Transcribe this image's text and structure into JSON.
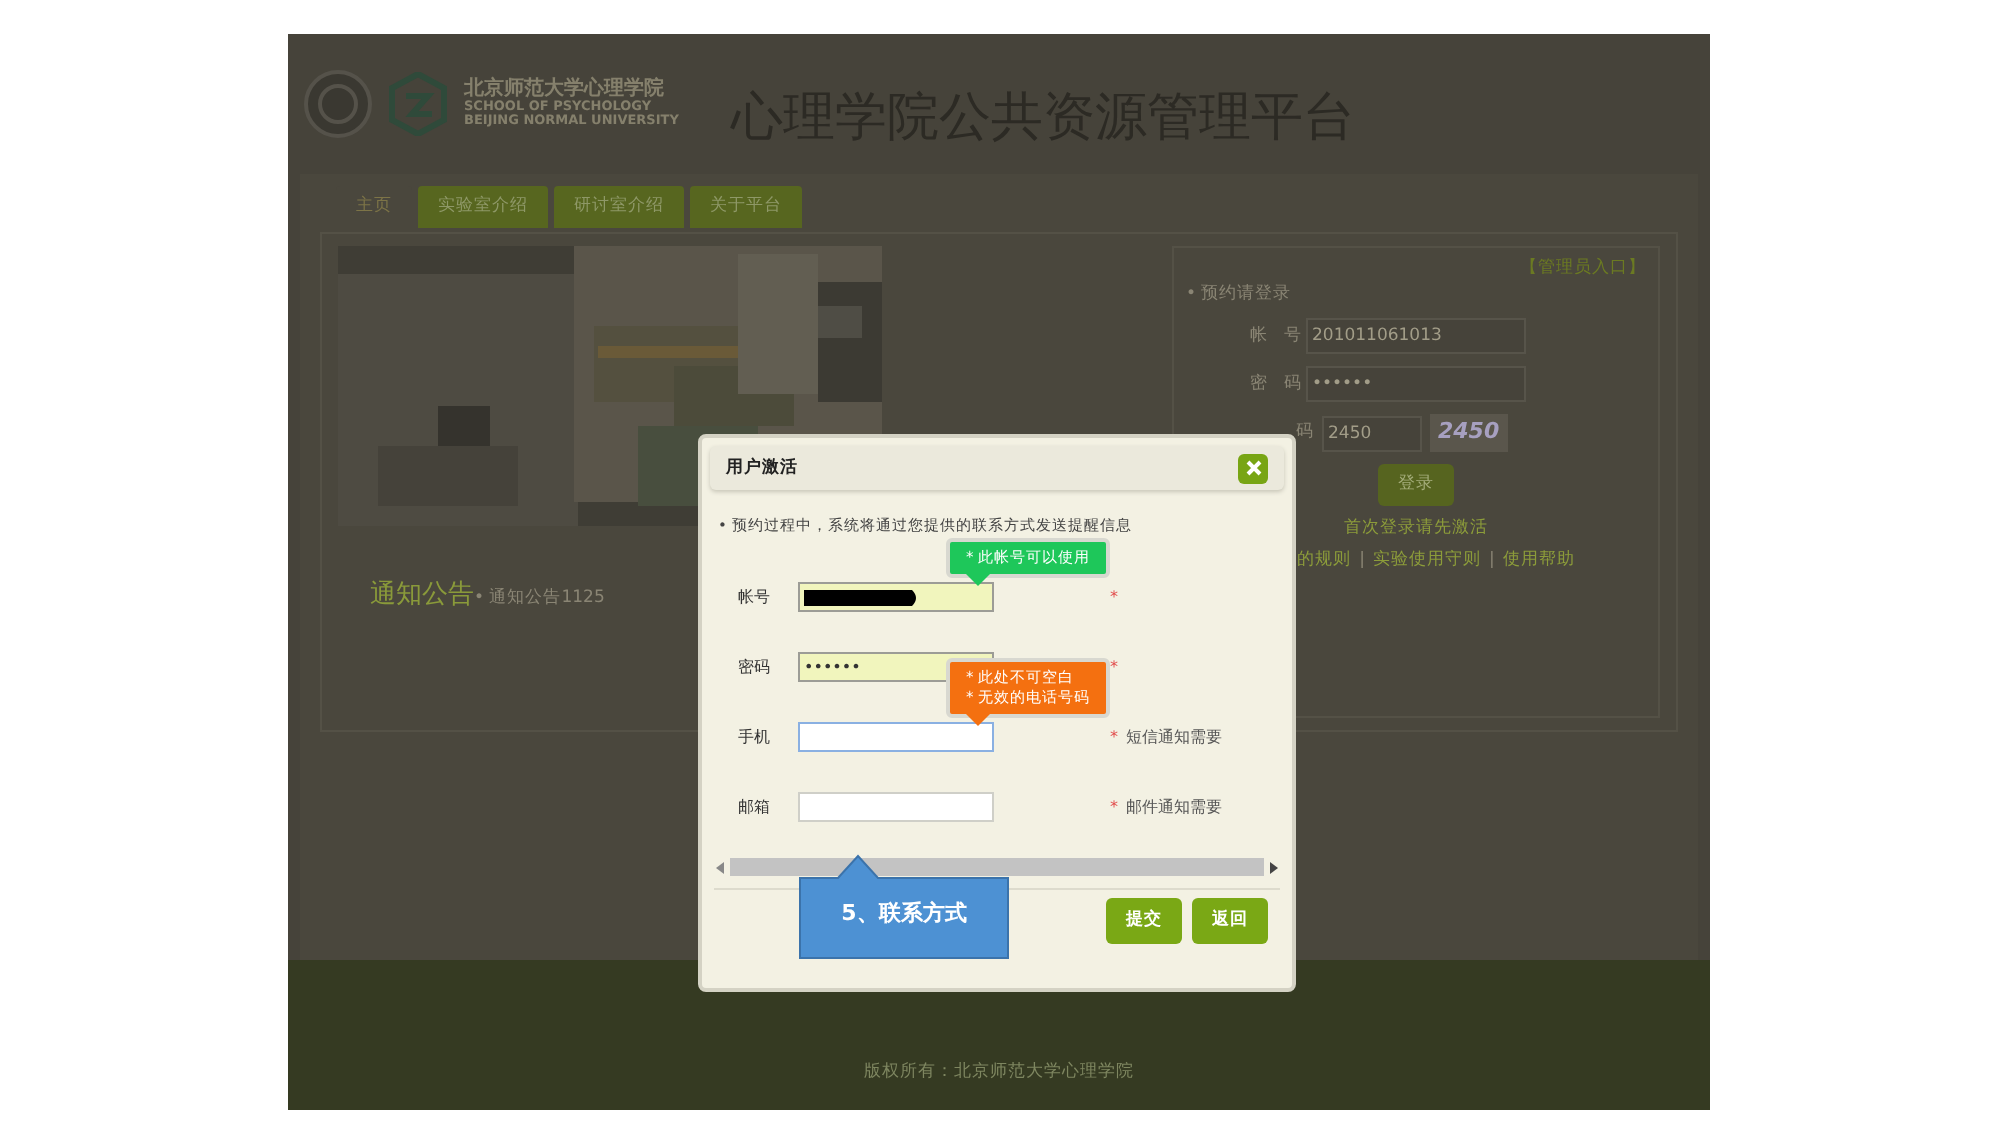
{
  "header": {
    "logo_title": "北京师范大学心理学院",
    "logo_subtitle_1": "SCHOOL OF PSYCHOLOGY",
    "logo_subtitle_2": "BEIJING NORMAL UNIVERSITY",
    "site_title": "心理学院公共资源管理平台"
  },
  "nav_tabs": [
    {
      "label": "主页",
      "selected": true
    },
    {
      "label": "实验室介绍",
      "selected": false
    },
    {
      "label": "研讨室介绍",
      "selected": false
    },
    {
      "label": "关于平台",
      "selected": false
    }
  ],
  "notices": {
    "heading": "通知公告",
    "items": [
      "• 通知公告1125"
    ]
  },
  "login": {
    "admin_link": "【管理员入口】",
    "heading": "• 预约请登录",
    "fields": [
      {
        "label": "帐号",
        "value": "201011061013"
      },
      {
        "label": "密码",
        "value": "••••••"
      },
      {
        "label": "码",
        "value": "2450",
        "captcha": "2450"
      }
    ],
    "button": "登录",
    "activate_link": "首次登录请先激活",
    "links": [
      "的规则",
      "实验使用守则",
      "使用帮助"
    ],
    "link_separator": "|"
  },
  "footer": "版权所有：北京师范大学心理学院",
  "dialog": {
    "title": "用户激活",
    "intro": "• 预约过程中，系统将通过您提供的联系方式发送提醒信息",
    "fields": [
      {
        "label": "帐号",
        "redacted": true,
        "highlighted": true,
        "focused": false,
        "mark": "*",
        "tooltip": {
          "kind": "success",
          "lines": [
            "* 此帐号可以使用"
          ]
        }
      },
      {
        "label": "密码",
        "value": "••••••",
        "highlighted": true,
        "focused": false,
        "mark": "*"
      },
      {
        "label": "手机",
        "highlighted": false,
        "focused": true,
        "mark": "*",
        "note": "短信通知需要",
        "tooltip": {
          "kind": "error",
          "lines": [
            "* 此处不可空白",
            "* 无效的电话号码"
          ]
        }
      },
      {
        "label": "邮箱",
        "highlighted": false,
        "focused": false,
        "mark": "*",
        "note": "邮件通知需要"
      }
    ],
    "buttons": [
      "提交",
      "返回"
    ]
  },
  "callout": "5、联系方式"
}
